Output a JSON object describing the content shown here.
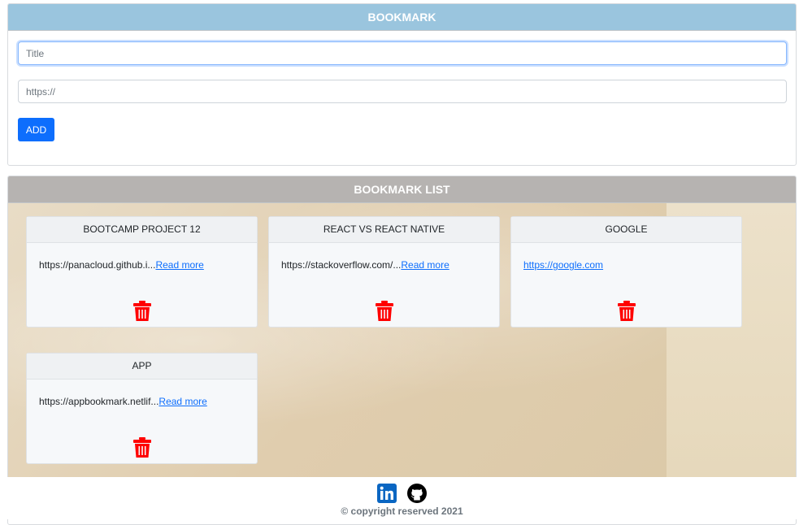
{
  "form": {
    "header": "BOOKMARK",
    "title_placeholder": "Title",
    "url_placeholder": "https://",
    "add_label": "ADD"
  },
  "list": {
    "header": "BOOKMARK LIST",
    "read_more": "Read more",
    "cards": [
      {
        "title": "BOOTCAMP PROJECT 12",
        "url": "https://panacloud.github.i..."
      },
      {
        "title": "REACT VS REACT NATIVE",
        "url": "https://stackoverflow.com/..."
      },
      {
        "title": "GOOGLE",
        "url": "https://google.com"
      },
      {
        "title": "APP",
        "url": "https://appbookmark.netlif..."
      }
    ]
  },
  "footer": {
    "copyright": "© copyright reserved 2021",
    "icons": [
      "linkedin-icon",
      "github-icon"
    ]
  },
  "colors": {
    "primary": "#0d6efd",
    "bookmark_header": "#9ac5de",
    "list_header": "#b6b3b1",
    "trash": "#ff0000"
  }
}
